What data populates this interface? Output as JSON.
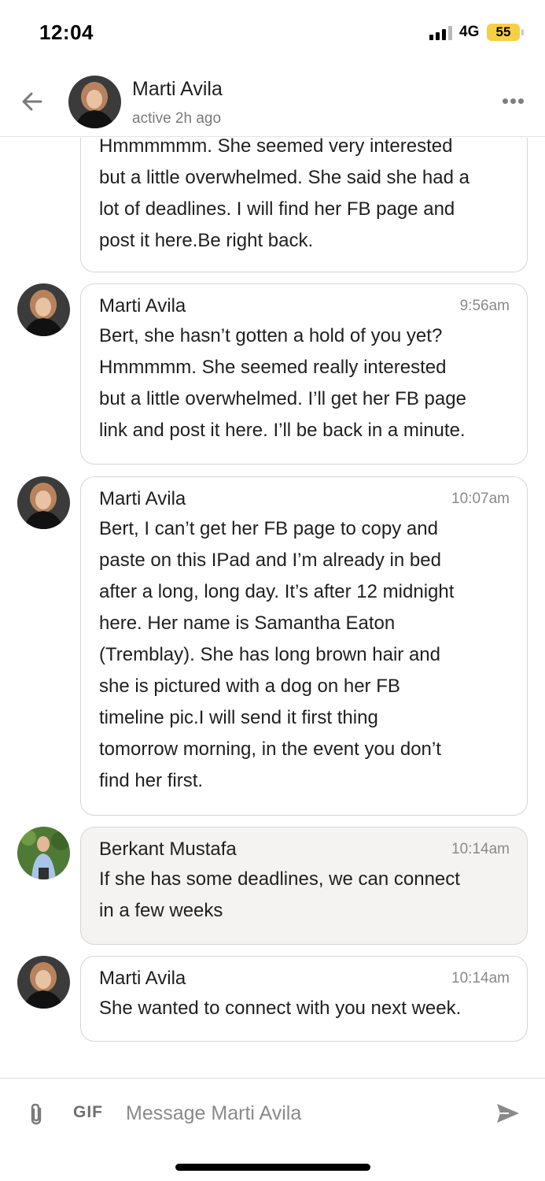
{
  "status_bar": {
    "time": "12:04",
    "network": "4G",
    "battery": "55",
    "battery_color": "#f7cf45",
    "signal_icon": "signal-bars-icon"
  },
  "header": {
    "back_icon": "arrow-left-icon",
    "contact_name": "Marti Avila",
    "contact_status": "active 2h ago",
    "more_icon": "more-horizontal-icon"
  },
  "messages": [
    {
      "sender": "",
      "time": "",
      "text": "Hmmmmmm. She seemed very interested\nbut a little overwhelmed. She said she had a\nlot of deadlines. I will find her FB page and\npost it here.Be right back."
    },
    {
      "sender": "Marti Avila",
      "time": "9:56am",
      "text": "Bert, she hasn’t gotten a hold of you yet?\nHmmmmm. She seemed really interested\nbut a little overwhelmed. I’ll get her FB page\nlink and post it here. I’ll be back in a minute."
    },
    {
      "sender": "Marti Avila",
      "time": "10:07am",
      "text": "Bert, I can’t get her FB page to copy and\npaste on this IPad and I’m already in bed\nafter a long, long day. It’s after 12 midnight\nhere. Her name is Samantha Eaton\n(Tremblay). She has long brown hair and\nshe is pictured with a dog on her FB\ntimeline pic.I will send it first thing\ntomorrow morning, in the event you don’t\nfind her first."
    },
    {
      "sender": "Berkant Mustafa",
      "time": "10:14am",
      "text": "If she has some deadlines, we can connect\nin a few weeks"
    },
    {
      "sender": "Marti Avila",
      "time": "10:14am",
      "text": "She wanted to connect with you next week."
    }
  ],
  "composer": {
    "attach_icon": "paperclip-icon",
    "gif_label": "GIF",
    "placeholder": "Message Marti Avila",
    "send_icon": "send-icon"
  },
  "colors": {
    "self_bubble": "#f4f3f2",
    "other_bubble": "#ffffff",
    "border": "#d6d6d6",
    "muted_text": "#8a8a8a"
  }
}
